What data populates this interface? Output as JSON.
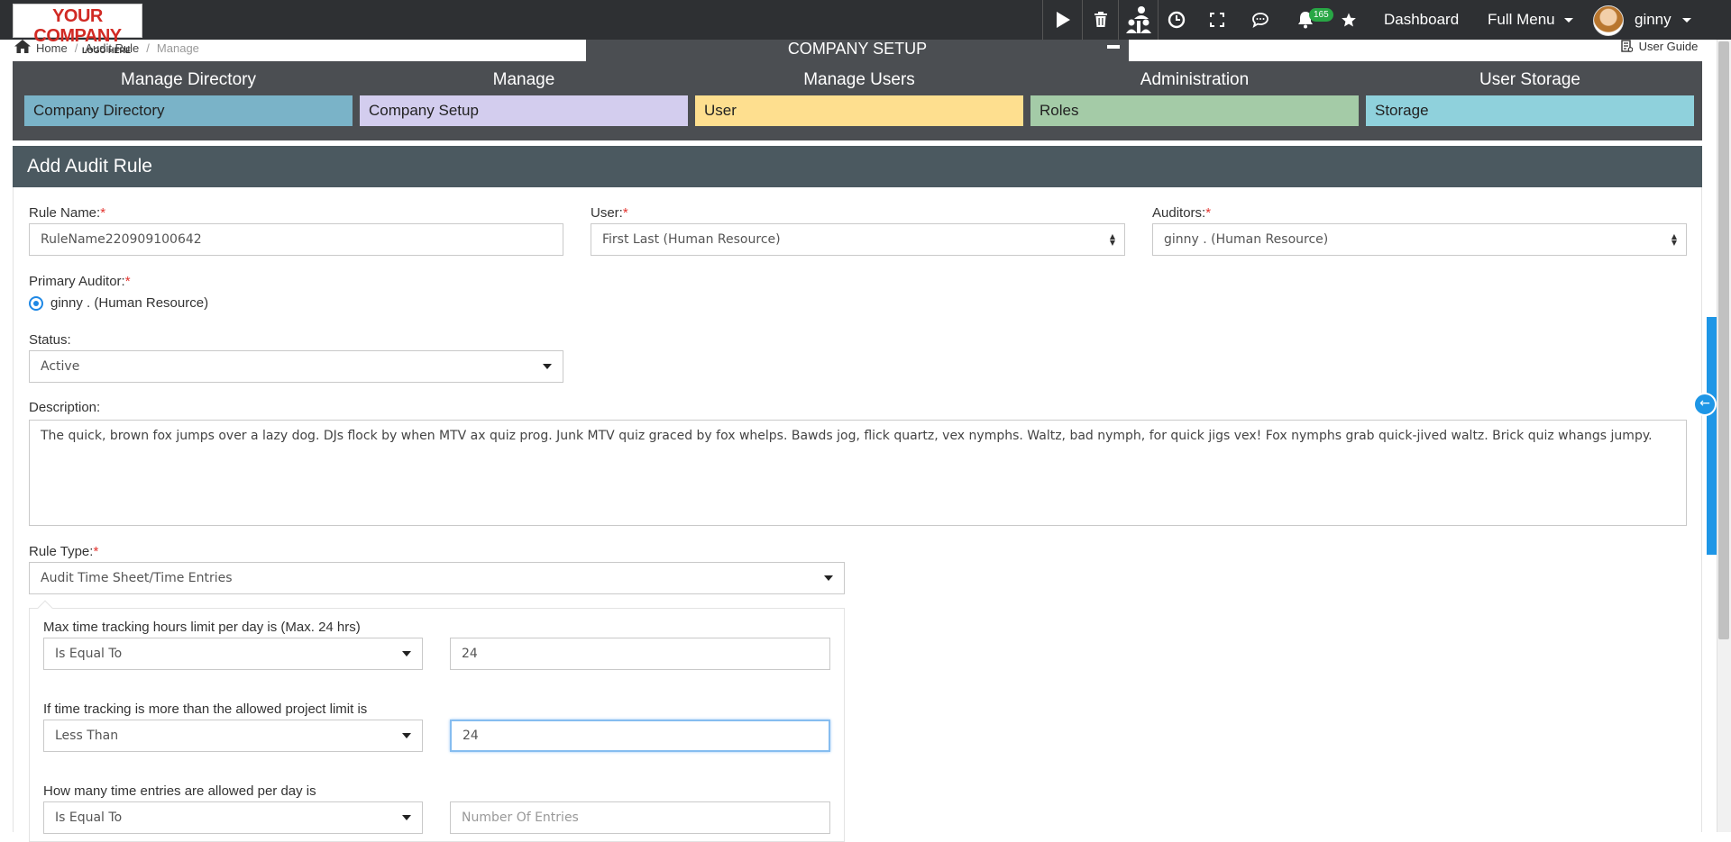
{
  "logo": {
    "line1": "YOUR COMPANY",
    "line2": "LOGO HERE"
  },
  "topbar": {
    "icons": [
      "play-icon",
      "trash-icon",
      "team-icon",
      "clock-icon",
      "fullscreen-icon",
      "chat-icon",
      "bell-icon",
      "star-icon"
    ],
    "notification_count": "165",
    "dashboard": "Dashboard",
    "full_menu": "Full Menu",
    "user_name": "ginny"
  },
  "breadcrumb": {
    "home": "Home",
    "audit_rule": "Audit Rule",
    "current": "Manage"
  },
  "company_setup_tab": "COMPANY SETUP",
  "user_guide": "User Guide",
  "menu": [
    {
      "heading": "Manage Directory",
      "link": "Company Directory",
      "color": "#7ab3c8"
    },
    {
      "heading": "Manage",
      "link": "Company Setup",
      "color": "#d3cdee"
    },
    {
      "heading": "Manage Users",
      "link": "User",
      "color": "#fedf8f"
    },
    {
      "heading": "Administration",
      "link": "Roles",
      "color": "#a4cba7"
    },
    {
      "heading": "User Storage",
      "link": "Storage",
      "color": "#8fd1dc"
    }
  ],
  "form": {
    "title": "Add Audit Rule",
    "rule_name": {
      "label": "Rule Name:",
      "required": "*",
      "value": "RuleName220909100642"
    },
    "user": {
      "label": "User:",
      "required": "*",
      "value": "First Last (Human Resource)"
    },
    "auditors": {
      "label": "Auditors:",
      "required": "*",
      "value": "ginny . (Human Resource)"
    },
    "primary_auditor": {
      "label": "Primary Auditor:",
      "required": "*",
      "option": "ginny . (Human Resource)"
    },
    "status": {
      "label": "Status:",
      "value": "Active"
    },
    "description": {
      "label": "Description:",
      "value": "The quick, brown fox jumps over a lazy dog. DJs flock by when MTV ax quiz prog. Junk MTV quiz graced by fox whelps. Bawds jog, flick quartz, vex nymphs. Waltz, bad nymph, for quick jigs vex! Fox nymphs grab quick-jived waltz. Brick quiz whangs jumpy."
    },
    "rule_type": {
      "label": "Rule Type:",
      "required": "*",
      "value": "Audit Time Sheet/Time Entries"
    },
    "max_hours": {
      "label": "Max time tracking hours limit per day is (Max. 24 hrs)",
      "operator": "Is Equal To",
      "value": "24"
    },
    "project_limit": {
      "label": "If time tracking is more than the allowed project limit is",
      "operator": "Less Than",
      "value": "24"
    },
    "entries_per_day": {
      "label": "How many time entries are allowed per day is",
      "operator": "Is Equal To",
      "placeholder": "Number Of Entries"
    }
  }
}
